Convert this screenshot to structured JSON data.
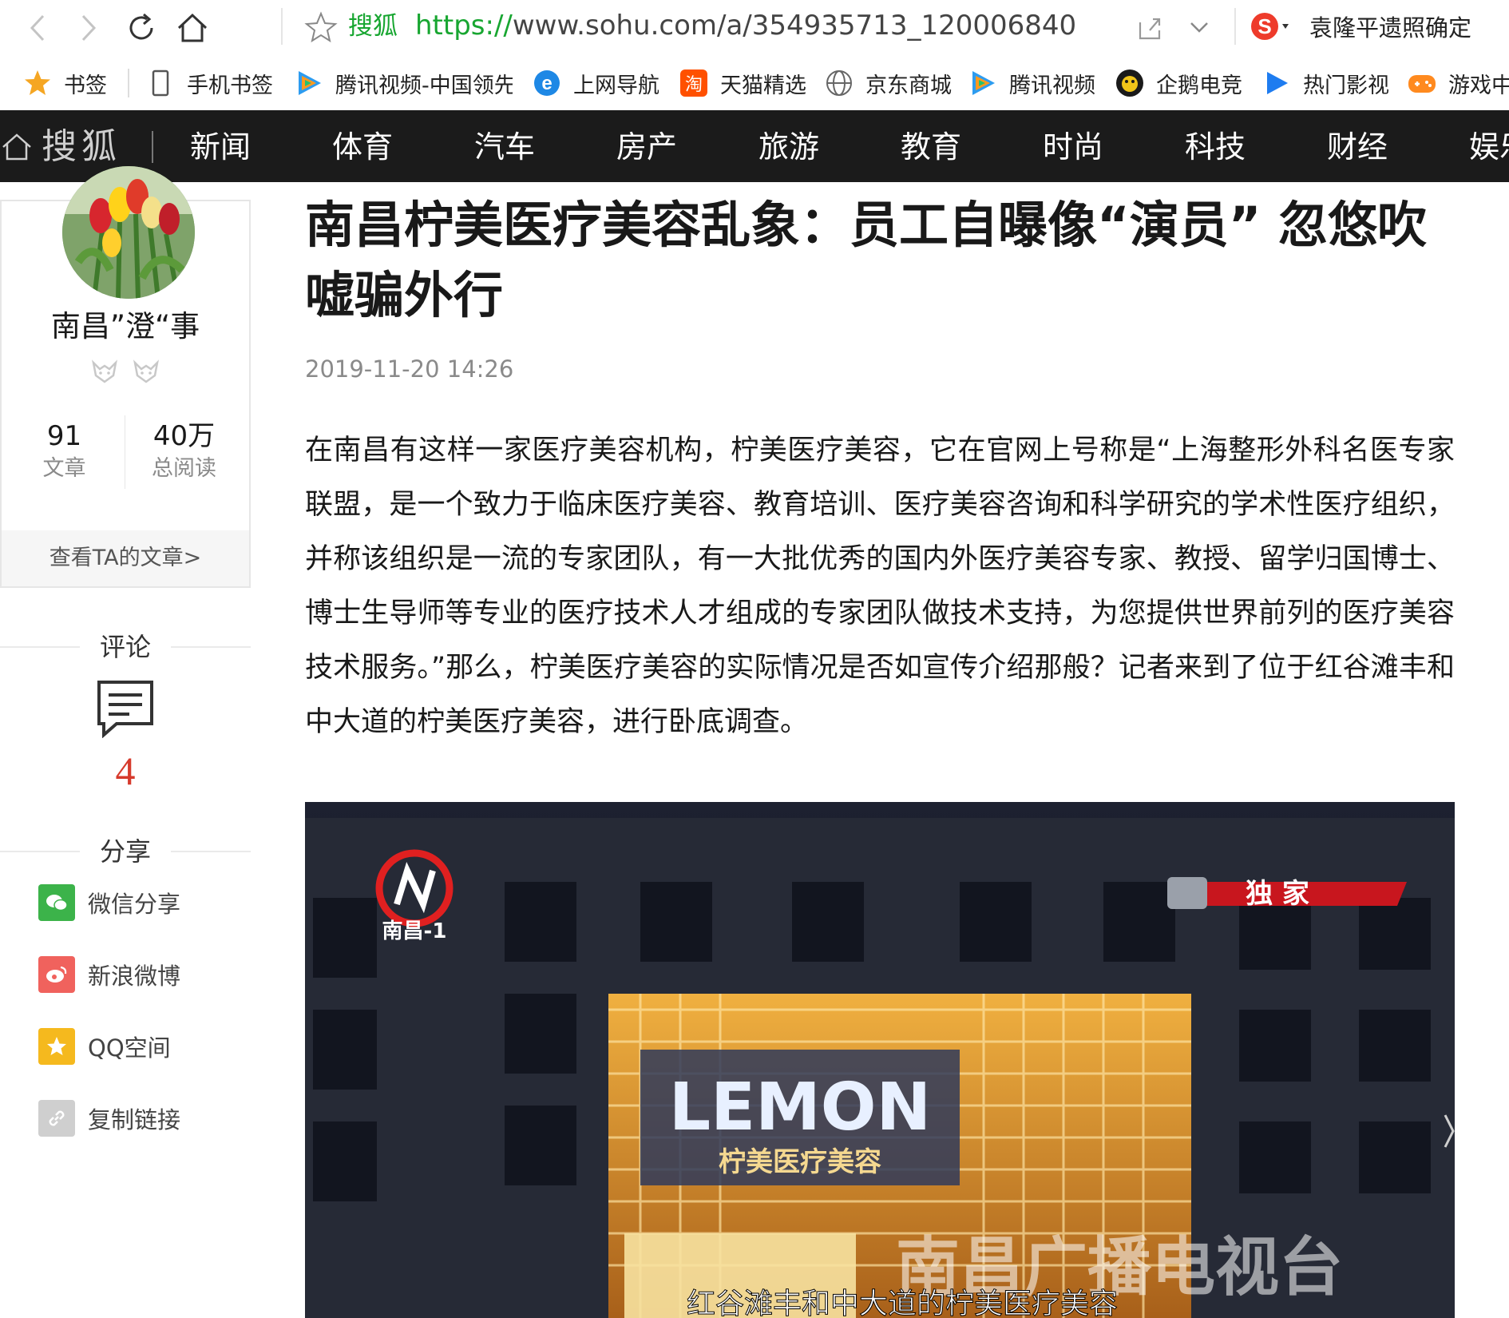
{
  "browser": {
    "site_name": "搜狐",
    "url_proto": "https://",
    "url_rest": "www.sohu.com/a/354935713_120006840",
    "search_hint": "袁隆平遗照确定"
  },
  "bookmarks": [
    {
      "label": "书签",
      "icon": "star-icon"
    },
    {
      "label": "手机书签",
      "icon": "phone-icon"
    },
    {
      "label": "腾讯视频-中国领先",
      "icon": "tencent-video-icon"
    },
    {
      "label": "上网导航",
      "icon": "ie-icon"
    },
    {
      "label": "天猫精选",
      "icon": "tmall-icon"
    },
    {
      "label": "京东商城",
      "icon": "globe-icon"
    },
    {
      "label": "腾讯视频",
      "icon": "tencent-video-icon"
    },
    {
      "label": "企鹅电竞",
      "icon": "penguin-icon"
    },
    {
      "label": "热门影视",
      "icon": "play-icon"
    },
    {
      "label": "游戏中",
      "icon": "gamepad-icon"
    }
  ],
  "channel_nav": {
    "logo": "搜狐",
    "items": [
      "新闻",
      "体育",
      "汽车",
      "房产",
      "旅游",
      "教育",
      "时尚",
      "科技",
      "财经",
      "娱乐"
    ]
  },
  "author": {
    "name": "南昌”澄“事",
    "articles_count": "91",
    "articles_label": "文章",
    "reads_count": "40万",
    "reads_label": "总阅读",
    "view_link": "查看TA的文章>"
  },
  "comments": {
    "label": "评论",
    "count": "4"
  },
  "share": {
    "label": "分享",
    "items": [
      {
        "label": "微信分享",
        "icon": "wechat-icon",
        "color": "#3cb34a"
      },
      {
        "label": "新浪微博",
        "icon": "weibo-icon",
        "color": "#f0625d"
      },
      {
        "label": "QQ空间",
        "icon": "qzone-icon",
        "color": "#f5b91e"
      },
      {
        "label": "复制链接",
        "icon": "link-icon",
        "color": "#c8c8c8"
      }
    ]
  },
  "article": {
    "title": "南昌柠美医疗美容乱象：员工自曝像“演员” 忽悠吹嘘骗外行",
    "date": "2019-11-20 14:26",
    "paragraph": "在南昌有这样一家医疗美容机构，柠美医疗美容，它在官网上号称是“上海整形外科名医专家联盟，是一个致力于临床医疗美容、教育培训、医疗美容咨询和科学研究的学术性医疗组织，并称该组织是一流的专家团队，有一大批优秀的国内外医疗美容专家、教授、留学归国博士、博士生导师等专业的医疗技术人才组成的专家团队做技术支持，为您提供世界前列的医疗美容技术服务。”那么，柠美医疗美容的实际情况是否如宣传介绍那般？记者来到了位于红谷滩丰和中大道的柠美医疗美容，进行卧底调查。"
  },
  "photo": {
    "channel_logo_text": "南昌-1",
    "exclusive_label": "独 家",
    "sign_text": "LEMON",
    "sign_subtext": "柠美医疗美容",
    "watermark": "南昌广播电视台",
    "subtitle": "红谷滩丰和中大道的柠美医疗美容"
  },
  "colors": {
    "accent_red": "#d63a2c",
    "channel_bg": "#1b1b1b",
    "url_green": "#18a631"
  }
}
